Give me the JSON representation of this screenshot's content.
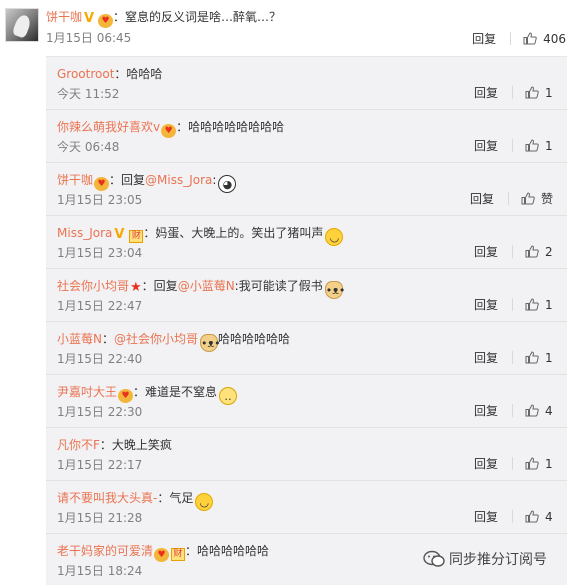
{
  "main": {
    "user": "饼干咖",
    "text": "：窒息的反义词是啥…醉氧…？",
    "time": "1月15日 06:45",
    "reply_label": "回复",
    "likes": "406"
  },
  "replies": [
    {
      "user": "Grootroot",
      "parts": [
        "：哈哈哈"
      ],
      "time": "今天 11:52",
      "reply_label": "回复",
      "likes": "1"
    },
    {
      "user": "你辣么萌我好喜欢v",
      "parts": [
        "：哈哈哈哈哈哈哈哈"
      ],
      "time": "今天 06:48",
      "reply_label": "回复",
      "likes": "1"
    },
    {
      "user": "饼干咖",
      "parts": [
        "：回复",
        "@Miss_Jora",
        ":"
      ],
      "time": "1月15日 23:05",
      "reply_label": "回复",
      "likes": "赞"
    },
    {
      "user": "Miss_Jora",
      "parts": [
        "：妈蛋、大晚上的。笑出了猪叫声"
      ],
      "time": "1月15日 23:04",
      "reply_label": "回复",
      "likes": "2"
    },
    {
      "user": "社会你小均哥",
      "parts": [
        "：回复",
        "@小蓝莓N",
        ":我可能读了假书"
      ],
      "time": "1月15日 22:47",
      "reply_label": "回复",
      "likes": "1"
    },
    {
      "user": "小蓝莓N",
      "parts": [
        "：",
        "@社会你小均哥",
        "哈哈哈哈哈哈"
      ],
      "time": "1月15日 22:40",
      "reply_label": "回复",
      "likes": "1"
    },
    {
      "user": "尹嘉吋大王",
      "parts": [
        "：难道是不窒息"
      ],
      "time": "1月15日 22:30",
      "reply_label": "回复",
      "likes": "4"
    },
    {
      "user": "凡你不F",
      "parts": [
        "：大晚上笑疯"
      ],
      "time": "1月15日 22:17",
      "reply_label": "回复",
      "likes": "1"
    },
    {
      "user": "请不要叫我大头真-",
      "parts": [
        "：气足"
      ],
      "time": "1月15日 21:28",
      "reply_label": "回复",
      "likes": "4"
    },
    {
      "user": "老干妈家的可爱清",
      "parts": [
        "：哈哈哈哈哈哈"
      ],
      "time": "1月15日 18:24",
      "reply_label": "回复",
      "likes": ""
    }
  ],
  "badges": {
    "v": "V",
    "cai": "财",
    "star": "★"
  },
  "watermark": "同步推分订阅号",
  "icons": [
    "thumbs-up-icon",
    "laughing-emoji",
    "doge-emoji",
    "panda-emoji",
    "sweat-emoji",
    "wechat-icon"
  ],
  "colors": {
    "username": "#eb7350",
    "time": "#808080",
    "reply_bg": "#f2f2f5"
  }
}
